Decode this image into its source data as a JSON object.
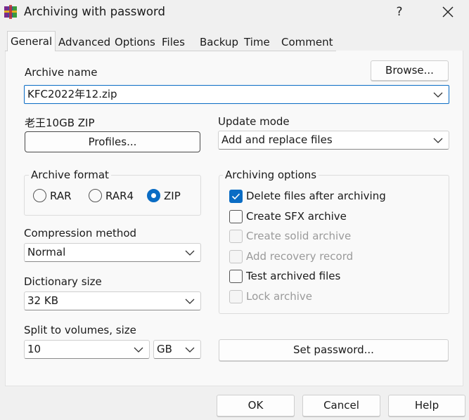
{
  "window": {
    "title": "Archiving with password",
    "help_glyph": "?"
  },
  "tabs": [
    {
      "label": "General",
      "active": true
    },
    {
      "label": "Advanced"
    },
    {
      "label": "Options"
    },
    {
      "label": "Files"
    },
    {
      "label": "Backup"
    },
    {
      "label": "Time"
    },
    {
      "label": "Comment"
    }
  ],
  "archive_name": {
    "label": "Archive name",
    "browse_label": "Browse...",
    "value": "KFC2022年12.zip"
  },
  "profile": {
    "name": "老王10GB ZIP",
    "button_label": "Profiles..."
  },
  "update_mode": {
    "label": "Update mode",
    "value": "Add and replace files"
  },
  "archive_format": {
    "title": "Archive format",
    "options": [
      {
        "label": "RAR",
        "selected": false
      },
      {
        "label": "RAR4",
        "selected": false
      },
      {
        "label": "ZIP",
        "selected": true
      }
    ]
  },
  "compression": {
    "label": "Compression method",
    "value": "Normal"
  },
  "dictionary": {
    "label": "Dictionary size",
    "value": "32 KB"
  },
  "split": {
    "label": "Split to volumes, size",
    "value": "10",
    "unit": "GB"
  },
  "archiving_options": {
    "title": "Archiving options",
    "items": [
      {
        "label": "Delete files after archiving",
        "checked": true,
        "enabled": true
      },
      {
        "label": "Create SFX archive",
        "checked": false,
        "enabled": true
      },
      {
        "label": "Create solid archive",
        "checked": false,
        "enabled": false
      },
      {
        "label": "Add recovery record",
        "checked": false,
        "enabled": false
      },
      {
        "label": "Test archived files",
        "checked": false,
        "enabled": true
      },
      {
        "label": "Lock archive",
        "checked": false,
        "enabled": false
      }
    ]
  },
  "set_password_label": "Set password...",
  "footer": {
    "ok_label": "OK",
    "cancel_label": "Cancel",
    "help_label": "Help"
  },
  "colors": {
    "accent": "#0a6cc4",
    "disabled_text": "#9a9a9a"
  }
}
